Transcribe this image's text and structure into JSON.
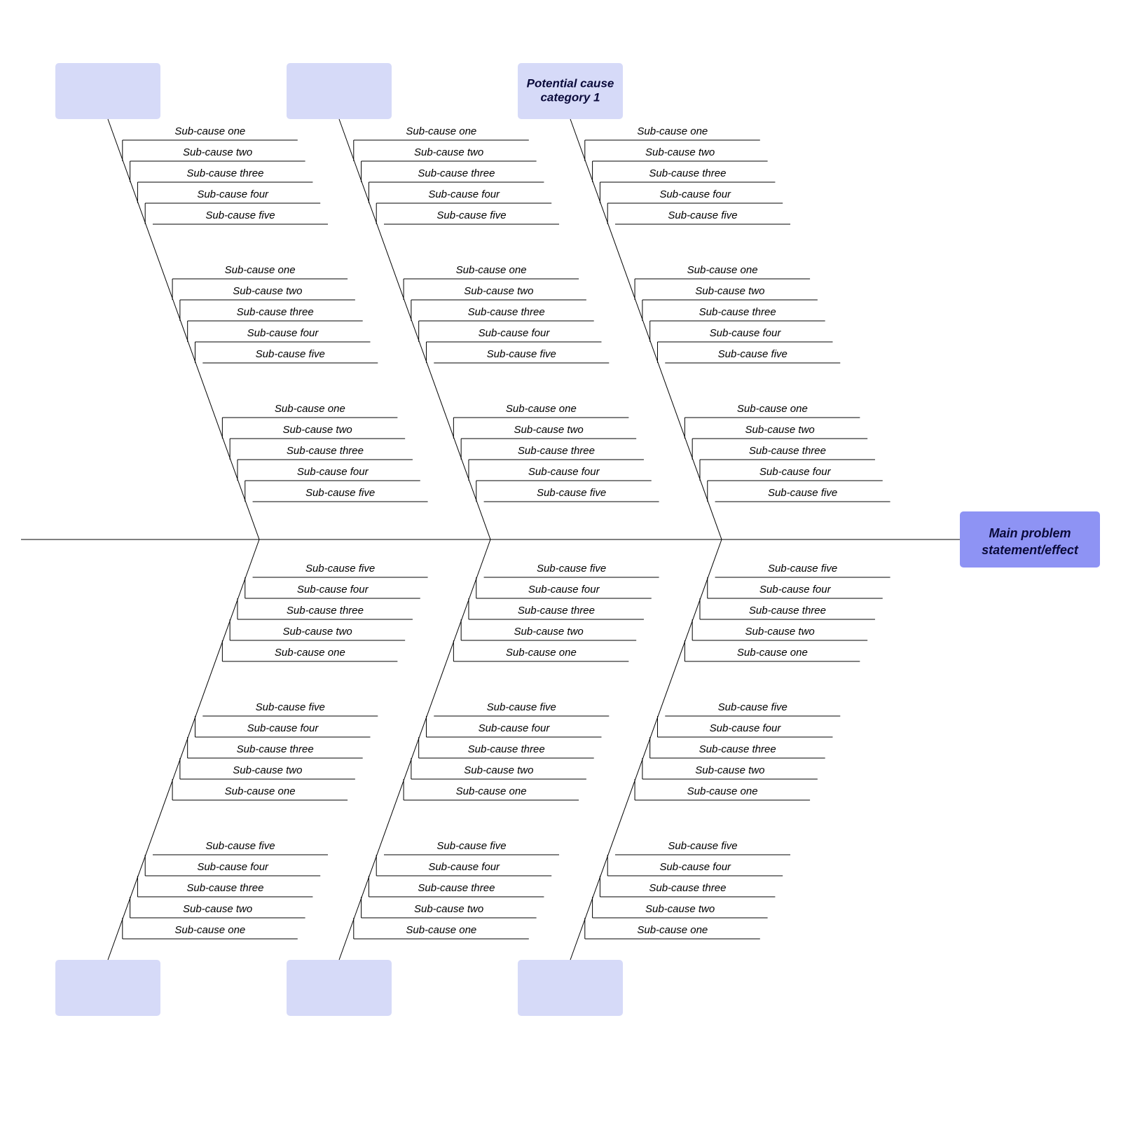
{
  "head": {
    "line1": "Main problem",
    "line2": "statement/effect"
  },
  "categories": {
    "top_right": "Potential cause\ncategory 1",
    "top_mid": "",
    "top_left": "",
    "bottom_right": "",
    "bottom_mid": "",
    "bottom_left": ""
  },
  "subcauses": [
    "Sub-cause one",
    "Sub-cause two",
    "Sub-cause three",
    "Sub-cause four",
    "Sub-cause five"
  ],
  "colors": {
    "category_box": "#d6daf8",
    "head_box": "#8e93f4",
    "line": "#000000"
  }
}
